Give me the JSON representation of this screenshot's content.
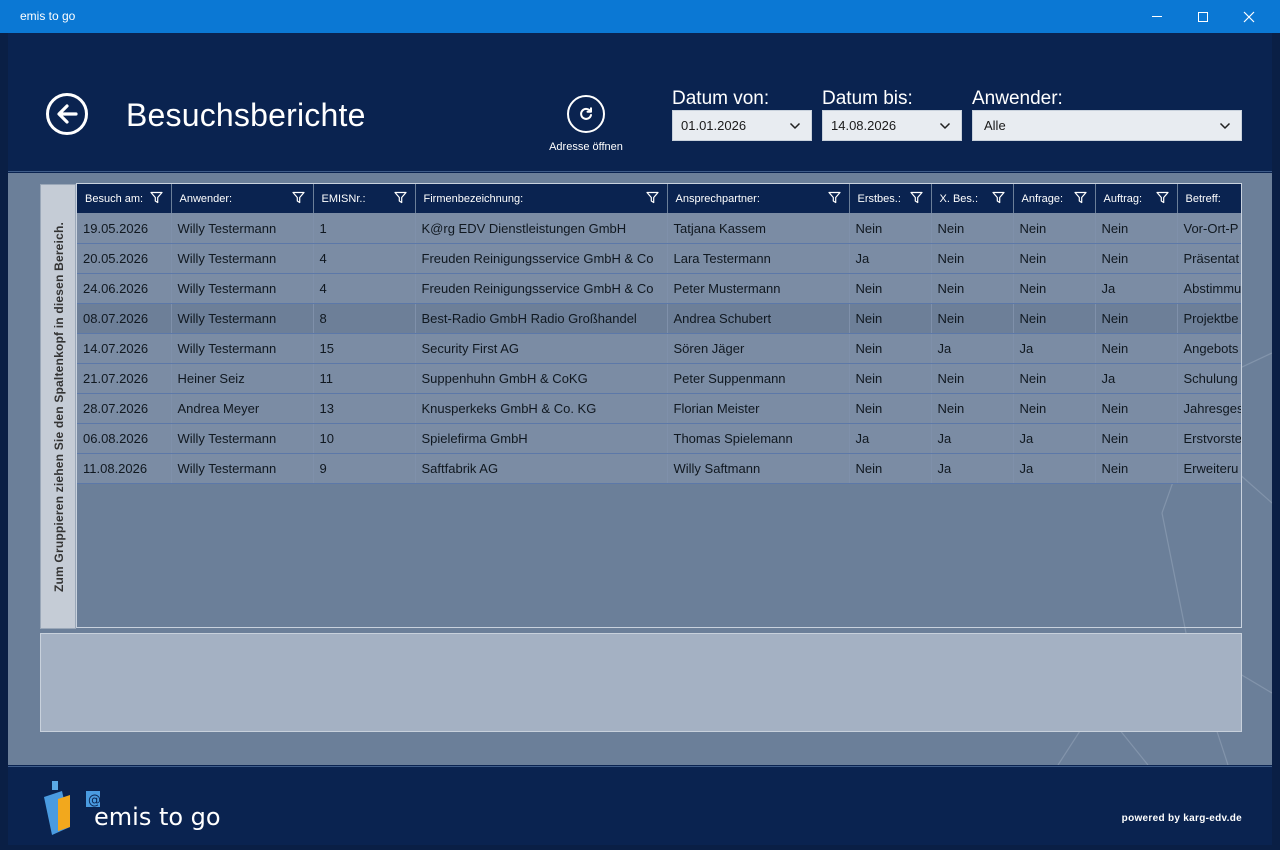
{
  "window": {
    "title": "emis to go"
  },
  "header": {
    "page_title": "Besuchsberichte",
    "open_address_label": "Adresse öffnen",
    "date_from_label": "Datum von:",
    "date_from_value": "01.01.2026",
    "date_to_label": "Datum bis:",
    "date_to_value": "14.08.2026",
    "user_label": "Anwender:",
    "user_value": "Alle"
  },
  "group_panel": {
    "hint": "Zum Gruppieren ziehen Sie den Spaltenkopf in diesen Bereich."
  },
  "grid": {
    "columns": [
      "Besuch am:",
      "Anwender:",
      "EMISNr.:",
      "Firmenbezeichnung:",
      "Ansprechpartner:",
      "Erstbes.:",
      "X. Bes.:",
      "Anfrage:",
      "Auftrag:",
      "Betreff:"
    ],
    "rows": [
      [
        "19.05.2026",
        "Willy Testermann",
        "1",
        "K@rg EDV Dienstleistungen GmbH",
        "Tatjana Kassem",
        "Nein",
        "Nein",
        "Nein",
        "Nein",
        "Vor-Ort-P"
      ],
      [
        "20.05.2026",
        "Willy Testermann",
        "4",
        "Freuden Reinigungsservice GmbH & Co",
        "Lara Testermann",
        "Ja",
        "Nein",
        "Nein",
        "Nein",
        "Präsentat"
      ],
      [
        "24.06.2026",
        "Willy Testermann",
        "4",
        "Freuden Reinigungsservice GmbH & Co",
        "Peter Mustermann",
        "Nein",
        "Nein",
        "Nein",
        "Ja",
        "Abstimmu"
      ],
      [
        "08.07.2026",
        "Willy Testermann",
        "8",
        "Best-Radio GmbH Radio Großhandel",
        "Andrea Schubert",
        "Nein",
        "Nein",
        "Nein",
        "Nein",
        "Projektbe"
      ],
      [
        "14.07.2026",
        "Willy Testermann",
        "15",
        "Security First AG",
        "Sören Jäger",
        "Nein",
        "Ja",
        "Ja",
        "Nein",
        "Angebots"
      ],
      [
        "21.07.2026",
        "Heiner Seiz",
        "11",
        "Suppenhuhn GmbH & CoKG",
        "Peter Suppenmann",
        "Nein",
        "Nein",
        "Nein",
        "Ja",
        "Schulung"
      ],
      [
        "28.07.2026",
        "Andrea Meyer",
        "13",
        "Knusperkeks GmbH & Co. KG",
        "Florian Meister",
        "Nein",
        "Nein",
        "Nein",
        "Nein",
        "Jahresges"
      ],
      [
        "06.08.2026",
        "Willy Testermann",
        "10",
        "Spielefirma GmbH",
        "Thomas Spielemann",
        "Ja",
        "Ja",
        "Ja",
        "Nein",
        "Erstvorste"
      ],
      [
        "11.08.2026",
        "Willy Testermann",
        "9",
        "Saftfabrik AG",
        "Willy Saftmann",
        "Nein",
        "Ja",
        "Ja",
        "Nein",
        "Erweiteru"
      ]
    ]
  },
  "footer": {
    "logo_text": "emis to go",
    "powered_by": "powered by karg-edv.de"
  },
  "colors": {
    "titlebar": "#0b78d4",
    "header_bg": "#0a2350",
    "main_bg": "#6b7f99",
    "row_bg": "#7b8ca4"
  }
}
